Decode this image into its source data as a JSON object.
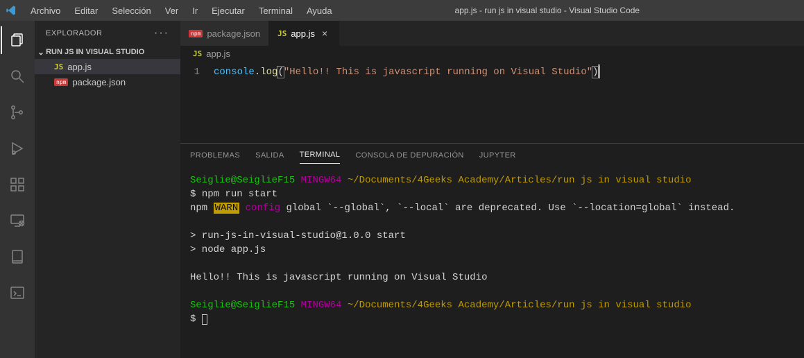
{
  "window": {
    "title": "app.js - run js in visual studio - Visual Studio Code"
  },
  "menu": {
    "archivo": "Archivo",
    "editar": "Editar",
    "seleccion": "Selección",
    "ver": "Ver",
    "ir": "Ir",
    "ejecutar": "Ejecutar",
    "terminal": "Terminal",
    "ayuda": "Ayuda"
  },
  "sidebar": {
    "header": "EXPLORADOR",
    "section": "RUN JS IN VISUAL STUDIO",
    "files": {
      "appjs": "app.js",
      "packagejson": "package.json"
    }
  },
  "tabs": {
    "packagejson": "package.json",
    "appjs": "app.js"
  },
  "breadcrumb": {
    "js": "JS",
    "name": "app.js"
  },
  "editor": {
    "line1_num": "1",
    "obj": "console",
    "dot": ".",
    "fn": "log",
    "lp": "(",
    "str": "\"Hello!! This is javascript running on Visual Studio\"",
    "rp": ")"
  },
  "panel": {
    "problemas": "PROBLEMAS",
    "salida": "SALIDA",
    "terminal": "TERMINAL",
    "consola": "CONSOLA DE DEPURACIÓN",
    "jupyter": "JUPYTER"
  },
  "term": {
    "user": "Seiglie@SeiglieF15",
    "shell": "MINGW64",
    "path": "~/Documents/4Geeks Academy/Articles/run js in visual studio",
    "dollar": "$ ",
    "cmd1": "npm run start",
    "npm_word": "npm",
    "warn_word": "WARN",
    "config_word": "config",
    "warn_rest": " global `--global`, `--local` are deprecated. Use `--location=global` instead.",
    "out1": "> run-js-in-visual-studio@1.0.0 start",
    "out2": "> node app.js",
    "out3": "Hello!! This is javascript running on Visual Studio"
  },
  "icons": {
    "js_badge": "JS",
    "npm_badge": "npm"
  }
}
